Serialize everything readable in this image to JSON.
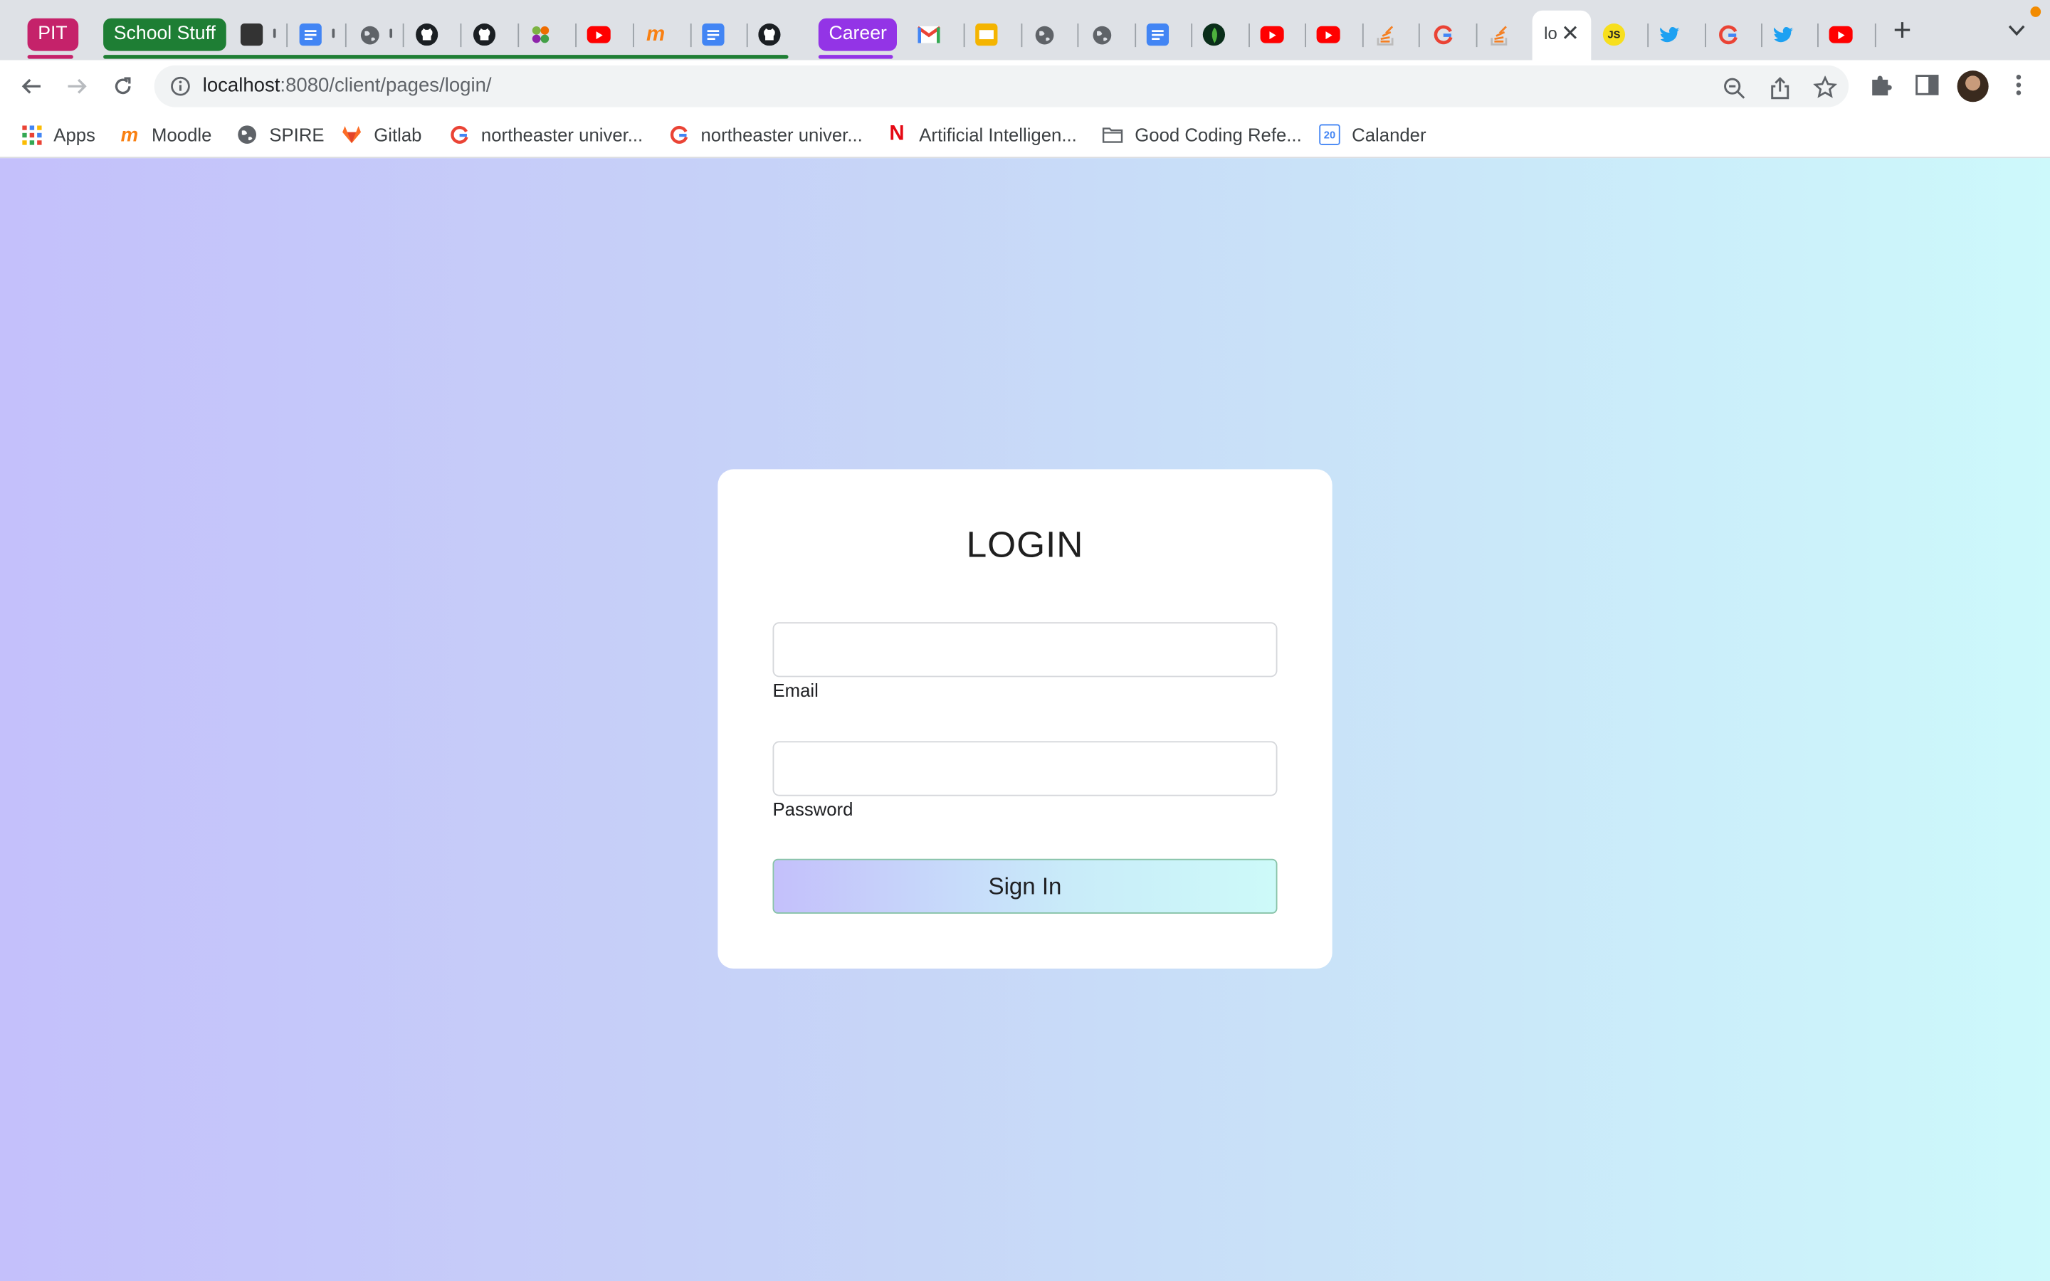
{
  "tab_groups": [
    {
      "label": "PIT",
      "color": "#c5226a"
    },
    {
      "label": "School Stuff",
      "color": "#1e7e34"
    },
    {
      "label": "Career",
      "color": "#9334e6"
    }
  ],
  "tab_icons": [
    "video-thumbnail-icon",
    "google-docs-icon",
    "globe-icon",
    "github-icon",
    "github-icon",
    "pinwheel-icon",
    "youtube-icon",
    "moodle-icon",
    "google-docs-icon",
    "github-icon",
    "gmail-icon",
    "google-slides-icon",
    "globe-icon",
    "globe-icon",
    "google-docs-icon",
    "mongodb-icon",
    "youtube-icon",
    "youtube-icon",
    "stackoverflow-icon",
    "google-icon",
    "stackoverflow-icon",
    "javascript-icon",
    "twitter-icon",
    "google-icon",
    "twitter-icon",
    "youtube-icon"
  ],
  "active_tab": {
    "label": "lo"
  },
  "address_bar": {
    "host": "localhost",
    "path": ":8080/client/pages/login/"
  },
  "bookmarks": [
    {
      "label": "Apps",
      "icon": "apps-grid-icon"
    },
    {
      "label": "Moodle",
      "icon": "moodle-icon"
    },
    {
      "label": "SPIRE",
      "icon": "globe-icon"
    },
    {
      "label": "Gitlab",
      "icon": "gitlab-icon"
    },
    {
      "label": "northeaster univer...",
      "icon": "google-icon"
    },
    {
      "label": "northeaster univer...",
      "icon": "google-icon"
    },
    {
      "label": "Artificial Intelligen...",
      "icon": "netflix-icon"
    },
    {
      "label": "Good Coding Refe...",
      "icon": "folder-icon"
    },
    {
      "label": "Calander",
      "icon": "google-calendar-icon",
      "badge": "20"
    }
  ],
  "login": {
    "title": "LOGIN",
    "email_label": "Email",
    "email_value": "",
    "password_label": "Password",
    "password_value": "",
    "submit_label": "Sign In"
  },
  "colors": {
    "page_gradient_start": "#c4c0fb",
    "page_gradient_end": "#cdf9fb",
    "tabstrip_bg": "#dee1e6"
  }
}
